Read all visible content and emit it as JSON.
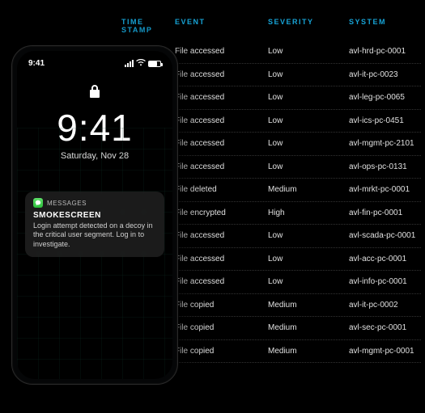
{
  "table": {
    "headers": {
      "time": "TIME STAMP",
      "event": "EVENT",
      "severity": "SEVERITY",
      "system": "SYSTEM"
    },
    "rows": [
      {
        "event": "File accessed",
        "severity": "Low",
        "system": "avl-hrd-pc-0001"
      },
      {
        "event": "File accessed",
        "severity": "Low",
        "system": "avl-it-pc-0023"
      },
      {
        "event": "File accessed",
        "severity": "Low",
        "system": "avl-leg-pc-0065"
      },
      {
        "event": "File accessed",
        "severity": "Low",
        "system": "avl-ics-pc-0451"
      },
      {
        "event": "File accessed",
        "severity": "Low",
        "system": "avl-mgmt-pc-2101"
      },
      {
        "event": "File accessed",
        "severity": "Low",
        "system": "avl-ops-pc-0131"
      },
      {
        "event": "File deleted",
        "severity": "Medium",
        "system": "avl-mrkt-pc-0001"
      },
      {
        "event": "File encrypted",
        "severity": "High",
        "system": "avl-fin-pc-0001"
      },
      {
        "event": "File accessed",
        "severity": "Low",
        "system": "avl-scada-pc-0001"
      },
      {
        "event": "File accessed",
        "severity": "Low",
        "system": "avl-acc-pc-0001"
      },
      {
        "event": "File accessed",
        "severity": "Low",
        "system": "avl-info-pc-0001"
      },
      {
        "event": "File copied",
        "severity": "Medium",
        "system": "avl-it-pc-0002"
      },
      {
        "event": "File copied",
        "severity": "Medium",
        "system": "avl-sec-pc-0001"
      },
      {
        "event": "File copied",
        "severity": "Medium",
        "system": "avl-mgmt-pc-0001"
      }
    ]
  },
  "phone": {
    "status_time": "9:41",
    "lock_time": "9:41",
    "date": "Saturday, Nov 28",
    "notification": {
      "app_label": "MESSAGES",
      "title": "SMOKESCREEN",
      "body": "Login attempt detected on a decoy in the critical user segment. Log in to investigate."
    }
  }
}
